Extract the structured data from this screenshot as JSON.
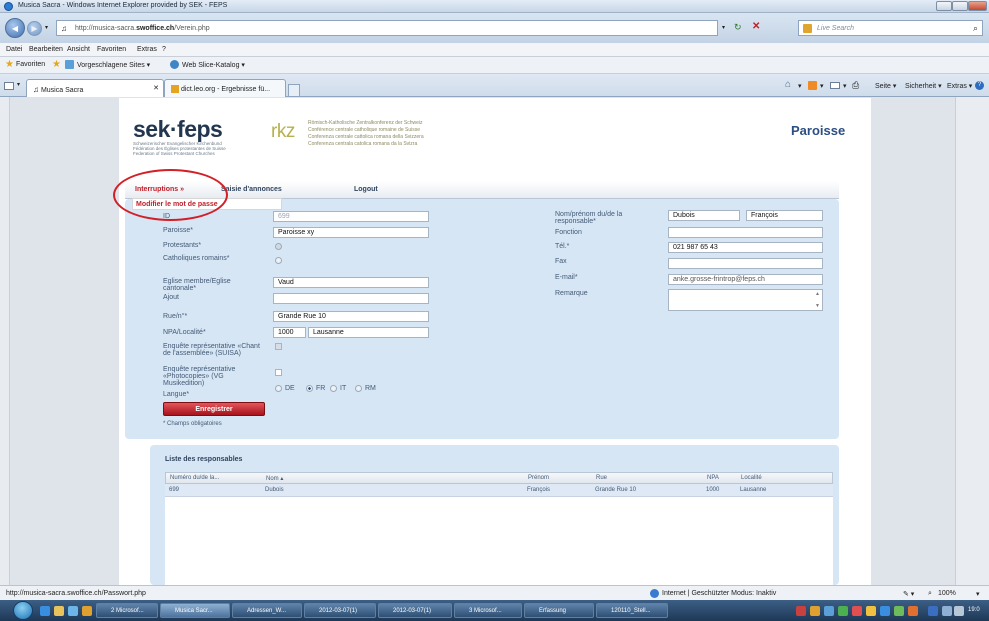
{
  "window": {
    "title": "Musica Sacra - Windows Internet Explorer provided by SEK - FEPS"
  },
  "address": {
    "url_prefix": "http://musica-sacra.",
    "url_domain": "swoffice.ch",
    "url_path": "/Verein.php",
    "search_placeholder": "Live Search"
  },
  "menu": [
    "Datei",
    "Bearbeiten",
    "Ansicht",
    "Favoriten",
    "Extras",
    "?"
  ],
  "favorites": {
    "label": "Favoriten",
    "items": [
      "Vorgeschlagene Sites ▾",
      "Web Slice-Katalog ▾"
    ]
  },
  "tabs": [
    {
      "label": "Musica Sacra"
    },
    {
      "label": "dict.leo.org - Ergebnisse fü..."
    }
  ],
  "commandbar": [
    "Seite ▾",
    "Sicherheit ▾",
    "Extras ▾"
  ],
  "site": {
    "logo_sek": "sek·feps",
    "logo_sek_lines": [
      "Schweizerischer Evangelischer Kirchenbund",
      "Fédération des Églises protestantes de Suisse",
      "Federation of Swiss Protestant Churches"
    ],
    "logo_rkz": "rkz",
    "logo_rkz_lines": [
      "Römisch-Katholische Zentralkonferenz der Schweiz",
      "Conférence centrale catholique romaine de Suisse",
      "Conferenza centrale cattolica romana della Svizzera",
      "Conferenza centrala catolica romana da la Svizra"
    ],
    "page_title": "Paroisse"
  },
  "nav": {
    "items": [
      "Interruptions »",
      "Saisie d'annonces",
      "Logout"
    ],
    "submenu_item": "Modifier le mot de passe"
  },
  "form": {
    "left": [
      {
        "label": "ID",
        "value": "699"
      },
      {
        "label": "Paroisse*",
        "value": "Paroisse xy"
      },
      {
        "label": "Protestants*"
      },
      {
        "label": "Catholiques romains*"
      },
      {
        "label": "Eglise membre/Eglise cantonale*",
        "value": "Vaud"
      },
      {
        "label": "Ajout",
        "value": ""
      },
      {
        "label": "Rue/n°*",
        "value": "Grande Rue 10"
      },
      {
        "label": "NPA/Localité*",
        "value": "1000",
        "value2": "Lausanne"
      },
      {
        "label": "Enquête représentative «Chant de l'assemblée» (SUISA)"
      },
      {
        "label": "Enquête représentative «Photocopies» (VG Musikedition)"
      },
      {
        "label": "Langue*"
      }
    ],
    "lang_options": [
      "DE",
      "FR",
      "IT",
      "RM"
    ],
    "lang_selected": "FR",
    "right": [
      {
        "label": "Nom/prénom du/de la responsable*",
        "value": "Dubois",
        "value2": "François"
      },
      {
        "label": "Fonction",
        "value": ""
      },
      {
        "label": "Tél.*",
        "value": "021 987 65 43"
      },
      {
        "label": "Fax",
        "value": ""
      },
      {
        "label": "E-mail*",
        "value": "anke.grosse-frintrop@feps.ch"
      },
      {
        "label": "Remarque",
        "value": ""
      }
    ],
    "save_label": "Enregistrer",
    "required_note": "* Champs obligatoires"
  },
  "list": {
    "title": "Liste des responsables",
    "headers": [
      "Numéro du/de la...",
      "Nom ▴",
      "Prénom",
      "Rue",
      "NPA",
      "Localité"
    ],
    "rows": [
      [
        "699",
        "Dubois",
        "François",
        "Grande Rue 10",
        "1000",
        "Lausanne"
      ]
    ]
  },
  "status": {
    "url": "http://musica-sacra.swoffice.ch/Passwort.php",
    "zone": "Internet | Geschützter Modus: Inaktiv",
    "zoom": "100%"
  },
  "taskbar": {
    "items": [
      "2 Microsof...",
      "Musica Sacr...",
      "Adressen_W...",
      "2012-03-07(1)",
      "2012-03-07(1)",
      "3 Microsof...",
      "Erfassung",
      "120110_Stell..."
    ],
    "clock": "19:0"
  }
}
